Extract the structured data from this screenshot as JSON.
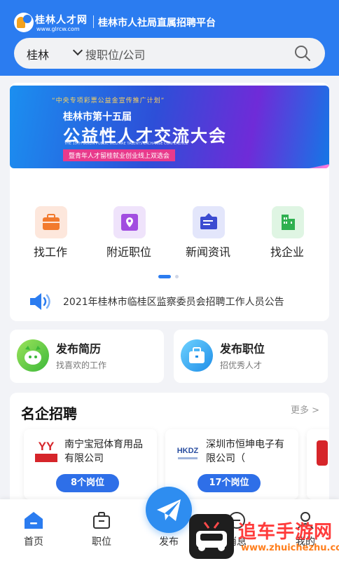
{
  "header": {
    "logo_name": "桂林人才网",
    "logo_url": "www.glrcw.com",
    "platform_title": "桂林市人社局直属招聘平台"
  },
  "search": {
    "city": "桂林",
    "placeholder": "搜职位/公司"
  },
  "banner": {
    "tag": "“中央专项彩票公益金宣传推广计划”",
    "line1": "桂林市第十五届",
    "line2": "公益性人才交流大会",
    "line_en": "THE 15TH GUILIN PUBLIC WELFARE TALENTS EXCHANGE CONFERENCE",
    "subline": "暨青年人才留桂就业创业线上双选会"
  },
  "nav": [
    {
      "label": "找工作",
      "icon": "briefcase-icon",
      "color": "#fde7dc"
    },
    {
      "label": "附近职位",
      "icon": "location-icon",
      "color": "#efe3fb"
    },
    {
      "label": "新闻资讯",
      "icon": "news-board-icon",
      "color": "#e3e6fb"
    },
    {
      "label": "找企业",
      "icon": "building-icon",
      "color": "#dff5e3"
    }
  ],
  "notice": {
    "text": "2021年桂林市临桂区监察委员会招聘工作人员公告"
  },
  "publish": [
    {
      "title": "发布简历",
      "subtitle": "找喜欢的工作",
      "icon": "robot-face-icon"
    },
    {
      "title": "发布职位",
      "subtitle": "招优秀人才",
      "icon": "briefcase-icon"
    }
  ],
  "famous": {
    "title": "名企招聘",
    "more": "更多 >",
    "companies": [
      {
        "name": "南宁宝冠体育用品有限公司",
        "jobs": "8个岗位",
        "logo_text": "YY"
      },
      {
        "name": "深圳市恒坤电子有限公司（",
        "jobs": "17个岗位",
        "logo_text": "HKDZ"
      }
    ]
  },
  "tabbar": [
    {
      "label": "首页",
      "icon": "home-icon",
      "active": true
    },
    {
      "label": "职位",
      "icon": "briefcase-outline-icon",
      "active": false
    },
    {
      "label": "发布",
      "icon": "paper-plane-icon",
      "active": false
    },
    {
      "label": "消息",
      "icon": "message-icon",
      "active": false
    },
    {
      "label": "我的",
      "icon": "user-icon",
      "active": false
    }
  ],
  "watermark": {
    "text": "追车手游网",
    "url": "www.zhuichezhu.com"
  },
  "colors": {
    "primary": "#2b7cf0",
    "job_badge": "#2e6fe8"
  }
}
